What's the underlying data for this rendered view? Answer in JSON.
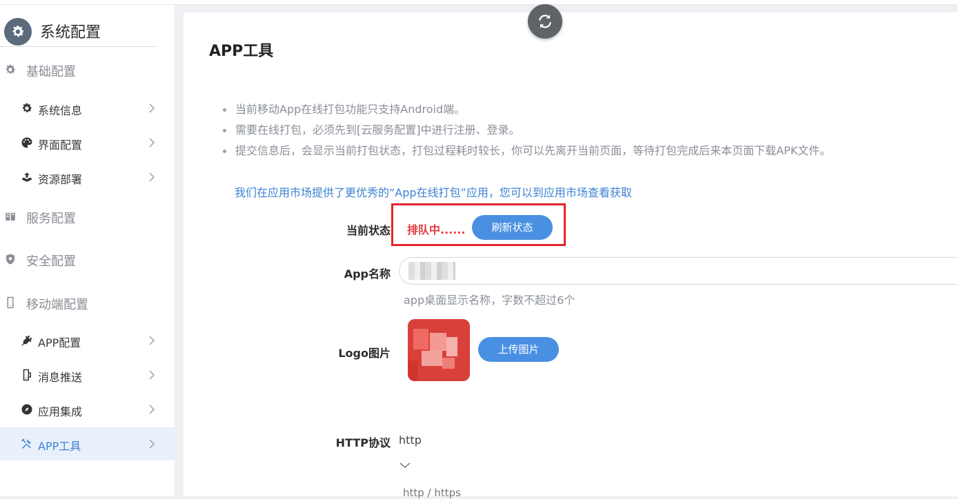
{
  "sidebar": {
    "title": "系统配置",
    "groups": [
      {
        "label": "基础配置",
        "icon": "gear-icon"
      },
      {
        "label": "服务配置",
        "icon": "server-icon"
      },
      {
        "label": "安全配置",
        "icon": "shield-icon"
      },
      {
        "label": "移动端配置",
        "icon": "mobile-icon"
      }
    ],
    "items": [
      {
        "label": "系统信息",
        "icon": "gear-icon"
      },
      {
        "label": "界面配置",
        "icon": "palette-icon"
      },
      {
        "label": "资源部署",
        "icon": "upload-icon"
      },
      {
        "label": "APP配置",
        "icon": "plug-icon"
      },
      {
        "label": "消息推送",
        "icon": "push-icon"
      },
      {
        "label": "应用集成",
        "icon": "compass-icon"
      },
      {
        "label": "APP工具",
        "icon": "tools-icon",
        "active": true
      }
    ]
  },
  "main": {
    "title": "APP工具",
    "notes": [
      "当前移动App在线打包功能只支持Android端。",
      "需要在线打包，必须先到[云服务配置]中进行注册、登录。",
      "提交信息后，会显示当前打包状态，打包过程耗时较长，你可以先离开当前页面，等待打包完成后来本页面下载APK文件。"
    ],
    "market_link": "我们在应用市场提供了更优秀的“App在线打包”应用，您可以到应用市场查看获取",
    "form": {
      "status_label": "当前状态",
      "status_value": "排队中......",
      "refresh_button": "刷新状态",
      "app_name_label": "App名称",
      "app_name_hint": "app桌面显示名称，字数不超过6个",
      "logo_label": "Logo图片",
      "upload_button": "上传图片",
      "http_label": "HTTP协议",
      "http_value": "http",
      "http_options": "http / https"
    }
  },
  "colors": {
    "accent": "#4a90e2",
    "status_red": "#e6393e",
    "highlight_box": "#e3252b",
    "link_blue": "#3a82d2"
  }
}
